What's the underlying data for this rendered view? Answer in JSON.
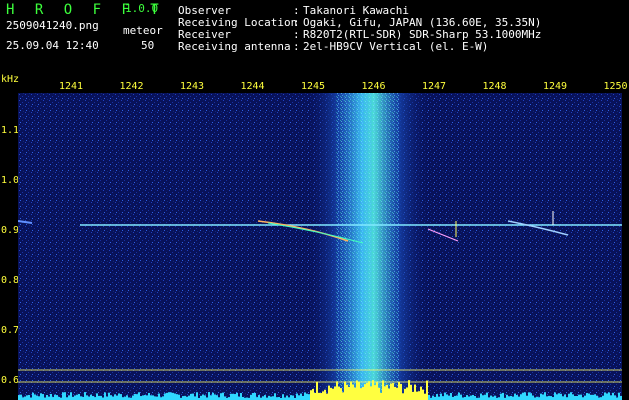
{
  "header": {
    "app_title": "H R O F F T",
    "app_version": "1.0.0",
    "filename": "2509041240.png",
    "datetime": "25.09.04 12:40",
    "meteor_label": "meteor",
    "meteor_count": "50"
  },
  "station_info": [
    {
      "key": "Observer",
      "value": "Takanori Kawachi"
    },
    {
      "key": "Receiving Location",
      "value": "Ogaki, Gifu, JAPAN (136.60E, 35.35N)"
    },
    {
      "key": "Receiver",
      "value": "R820T2(RTL-SDR) SDR-Sharp 53.1000MHz"
    },
    {
      "key": "Receiving antenna",
      "value": "2el-HB9CV Vertical (el. E-W)"
    }
  ],
  "separator": ":",
  "freq_axis": {
    "unit": "kHz",
    "ticks": [
      "1241",
      "1242",
      "1243",
      "1244",
      "1245",
      "1246",
      "1247",
      "1248",
      "1249",
      "1250"
    ]
  },
  "khz_axis": {
    "ticks": [
      "1.1",
      "1.0",
      "0.9",
      "0.8",
      "0.7",
      "0.6"
    ]
  },
  "colors": {
    "background": "#000000",
    "text_white": "#ffffff",
    "text_green": "#3cff3c",
    "text_yellow": "#ffff3c",
    "noise_floor": "#0a1a6e",
    "signal_band": "#40c8ff",
    "marker_line": "#ffff66"
  }
}
